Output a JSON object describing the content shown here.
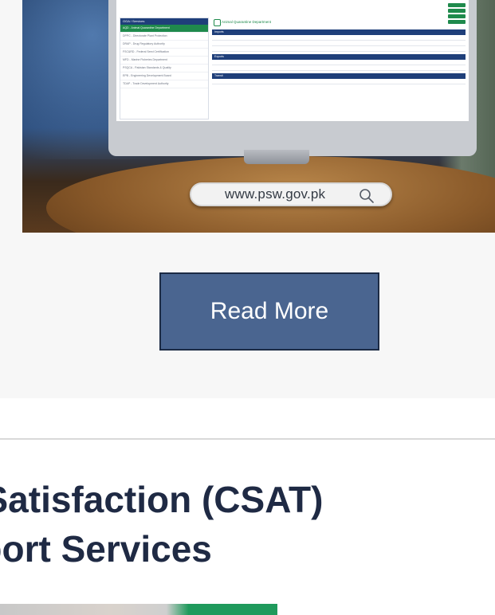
{
  "hero": {
    "url_text": "www.psw.gov.pk",
    "screen": {
      "sidebar_title": "OGA / Services",
      "sidebar_items": [
        "AQD - Animal Quarantine Department",
        "DPPC - Directorate Plant Protection",
        "DRAP - Drug Regulatory Authority",
        "FSC&RD - Federal Seed Certification",
        "MFD - Marine Fisheries Department",
        "PSQCA - Pakistan Standards & Quality",
        "EPB - Engineering Development Board",
        "TDAP - Trade Development Authority"
      ],
      "department": "Animal Quarantine Department",
      "bands": [
        "Imports",
        "Exports",
        "Transit"
      ]
    }
  },
  "cta": {
    "read_more_label": "Read More"
  },
  "section": {
    "heading_line1": "Customer Satisfaction (CSAT)",
    "heading_line2": "Email Support Services"
  },
  "colors": {
    "button_bg": "#4a6590",
    "button_border": "#1c2b45",
    "heading": "#1f2a44",
    "accent_green": "#1f8a4c",
    "navy": "#1f3f7a"
  }
}
